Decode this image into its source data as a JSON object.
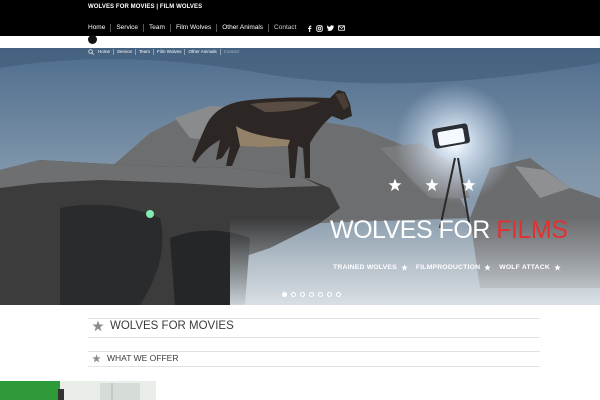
{
  "header": {
    "site_title": "WOLVES FOR MOVIES | FILM WOLVES",
    "nav": [
      "Home",
      "Service",
      "Team",
      "Film Wolves",
      "Other Animals",
      "Contact"
    ],
    "social_icons": [
      "facebook-icon",
      "instagram-icon",
      "twitter-icon",
      "email-icon"
    ]
  },
  "hero": {
    "subnav": [
      "Home",
      "Service",
      "Team",
      "Film Wolves",
      "Other Animals",
      "Contact"
    ],
    "title_main": "WOLVES FOR ",
    "title_accent": "FILMS",
    "links": [
      "TRAINED WOLVES",
      "FILMPRODUCTION",
      "WOLF ATTACK"
    ],
    "slide_count": 7,
    "active_slide": 1,
    "accent_color": "#e03232"
  },
  "sections": {
    "primary_heading": "WOLVES FOR MOVIES",
    "secondary_heading": "WHAT WE OFFER"
  }
}
